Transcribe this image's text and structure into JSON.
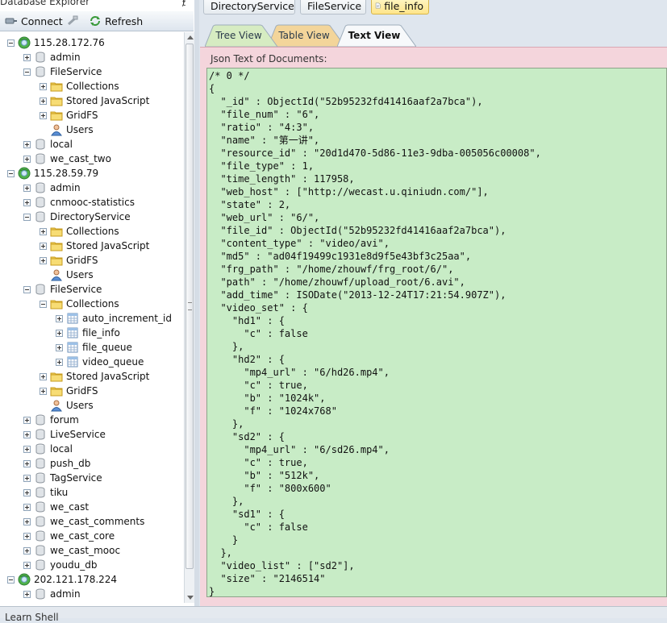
{
  "explorer": {
    "title": "Database Explorer",
    "pin_glyph": "ⱦ",
    "toolbar": {
      "connect_label": "Connect",
      "refresh_label": "Refresh"
    }
  },
  "tree": [
    {
      "level": 0,
      "label": "115.28.172.76",
      "icon": "server-icon",
      "exp": "minus"
    },
    {
      "level": 1,
      "label": "admin",
      "icon": "database-icon",
      "exp": "plus"
    },
    {
      "level": 1,
      "label": "FileService",
      "icon": "database-icon",
      "exp": "minus"
    },
    {
      "level": 2,
      "label": "Collections",
      "icon": "folder-icon",
      "exp": "plus"
    },
    {
      "level": 2,
      "label": "Stored JavaScript",
      "icon": "folder-icon",
      "exp": "plus"
    },
    {
      "level": 2,
      "label": "GridFS",
      "icon": "folder-icon",
      "exp": "plus"
    },
    {
      "level": 2,
      "label": "Users",
      "icon": "user-icon",
      "exp": "none"
    },
    {
      "level": 1,
      "label": "local",
      "icon": "database-icon",
      "exp": "plus"
    },
    {
      "level": 1,
      "label": "we_cast_two",
      "icon": "database-icon",
      "exp": "plus"
    },
    {
      "level": 0,
      "label": "115.28.59.79",
      "icon": "server-icon",
      "exp": "minus"
    },
    {
      "level": 1,
      "label": "admin",
      "icon": "database-icon",
      "exp": "plus"
    },
    {
      "level": 1,
      "label": "cnmooc-statistics",
      "icon": "database-icon",
      "exp": "plus"
    },
    {
      "level": 1,
      "label": "DirectoryService",
      "icon": "database-icon",
      "exp": "minus"
    },
    {
      "level": 2,
      "label": "Collections",
      "icon": "folder-icon",
      "exp": "plus"
    },
    {
      "level": 2,
      "label": "Stored JavaScript",
      "icon": "folder-icon",
      "exp": "plus"
    },
    {
      "level": 2,
      "label": "GridFS",
      "icon": "folder-icon",
      "exp": "plus"
    },
    {
      "level": 2,
      "label": "Users",
      "icon": "user-icon",
      "exp": "none"
    },
    {
      "level": 1,
      "label": "FileService",
      "icon": "database-icon",
      "exp": "minus"
    },
    {
      "level": 2,
      "label": "Collections",
      "icon": "folder-icon",
      "exp": "minus"
    },
    {
      "level": 3,
      "label": "auto_increment_id",
      "icon": "table-icon",
      "exp": "plus"
    },
    {
      "level": 3,
      "label": "file_info",
      "icon": "table-icon",
      "exp": "plus"
    },
    {
      "level": 3,
      "label": "file_queue",
      "icon": "table-icon",
      "exp": "plus"
    },
    {
      "level": 3,
      "label": "video_queue",
      "icon": "table-icon",
      "exp": "plus"
    },
    {
      "level": 2,
      "label": "Stored JavaScript",
      "icon": "folder-icon",
      "exp": "plus"
    },
    {
      "level": 2,
      "label": "GridFS",
      "icon": "folder-icon",
      "exp": "plus"
    },
    {
      "level": 2,
      "label": "Users",
      "icon": "user-icon",
      "exp": "none"
    },
    {
      "level": 1,
      "label": "forum",
      "icon": "database-icon",
      "exp": "plus"
    },
    {
      "level": 1,
      "label": "LiveService",
      "icon": "database-icon",
      "exp": "plus"
    },
    {
      "level": 1,
      "label": "local",
      "icon": "database-icon",
      "exp": "plus"
    },
    {
      "level": 1,
      "label": "push_db",
      "icon": "database-icon",
      "exp": "plus"
    },
    {
      "level": 1,
      "label": "TagService",
      "icon": "database-icon",
      "exp": "plus"
    },
    {
      "level": 1,
      "label": "tiku",
      "icon": "database-icon",
      "exp": "plus"
    },
    {
      "level": 1,
      "label": "we_cast",
      "icon": "database-icon",
      "exp": "plus"
    },
    {
      "level": 1,
      "label": "we_cast_comments",
      "icon": "database-icon",
      "exp": "plus"
    },
    {
      "level": 1,
      "label": "we_cast_core",
      "icon": "database-icon",
      "exp": "plus"
    },
    {
      "level": 1,
      "label": "we_cast_mooc",
      "icon": "database-icon",
      "exp": "plus"
    },
    {
      "level": 1,
      "label": "youdu_db",
      "icon": "database-icon",
      "exp": "plus"
    },
    {
      "level": 0,
      "label": "202.121.178.224",
      "icon": "server-icon",
      "exp": "minus"
    },
    {
      "level": 1,
      "label": "admin",
      "icon": "database-icon",
      "exp": "plus"
    }
  ],
  "doc_tabs": [
    {
      "label": "DirectoryService",
      "active": false
    },
    {
      "label": "FileService",
      "active": false
    },
    {
      "label": "file_info",
      "active": true
    }
  ],
  "view_tabs": [
    {
      "label": "Tree View",
      "color": "#d6ecc2",
      "active": false
    },
    {
      "label": "Table View",
      "color": "#f3d59a",
      "active": false
    },
    {
      "label": "Text View",
      "color": "#f7f9fb",
      "active": true
    }
  ],
  "json_caption": "Json Text of Documents:",
  "json_text": [
    "/* 0 */",
    "{",
    "  \"_id\" : ObjectId(\"52b95232fd41416aaf2a7bca\"),",
    "  \"file_num\" : \"6\",",
    "  \"ratio\" : \"4:3\",",
    "  \"name\" : \"第一讲\",",
    "  \"resource_id\" : \"20d1d470-5d86-11e3-9dba-005056c00008\",",
    "  \"file_type\" : 1,",
    "  \"time_length\" : 117958,",
    "  \"web_host\" : [\"http://wecast.u.qiniudn.com/\"],",
    "  \"state\" : 2,",
    "  \"web_url\" : \"6/\",",
    "  \"file_id\" : ObjectId(\"52b95232fd41416aaf2a7bca\"),",
    "  \"content_type\" : \"video/avi\",",
    "  \"md5\" : \"ad04f19499c1931e8d9f5e43bf3c25aa\",",
    "  \"frg_path\" : \"/home/zhouwf/frg_root/6/\",",
    "  \"path\" : \"/home/zhouwf/upload_root/6.avi\",",
    "  \"add_time\" : ISODate(\"2013-12-24T17:21:54.907Z\"),",
    "  \"video_set\" : {",
    "    \"hd1\" : {",
    "      \"c\" : false",
    "    },",
    "    \"hd2\" : {",
    "      \"mp4_url\" : \"6/hd26.mp4\",",
    "      \"c\" : true,",
    "      \"b\" : \"1024k\",",
    "      \"f\" : \"1024x768\"",
    "    },",
    "    \"sd2\" : {",
    "      \"mp4_url\" : \"6/sd26.mp4\",",
    "      \"c\" : true,",
    "      \"b\" : \"512k\",",
    "      \"f\" : \"800x600\"",
    "    },",
    "    \"sd1\" : {",
    "      \"c\" : false",
    "    }",
    "  },",
    "  \"video_list\" : [\"sd2\"],",
    "  \"size\" : \"2146514\"",
    "}"
  ],
  "bottom_label": "Learn Shell"
}
